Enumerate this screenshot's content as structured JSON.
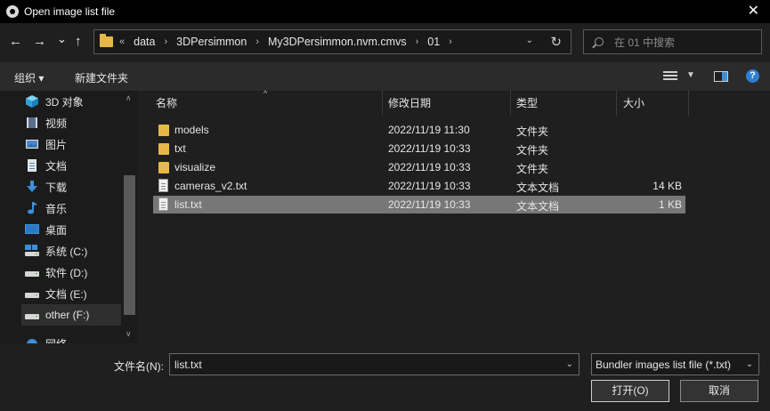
{
  "window": {
    "title": "Open image list file",
    "close_glyph": "✕"
  },
  "nav": {
    "back_glyph": "←",
    "forward_glyph": "→",
    "recent_glyph": "⌄",
    "up_glyph": "↑",
    "breadcrumb_overflow": "«",
    "breadcrumbs": [
      "data",
      "3DPersimmon",
      "My3DPersimmon.nvm.cmvs",
      "01"
    ],
    "search_placeholder": "在 01 中搜索"
  },
  "toolbar": {
    "organize": "组织 ▾",
    "new_folder": "新建文件夹",
    "help": "?"
  },
  "sidebar": {
    "items": [
      {
        "label": "3D 对象",
        "icon": "cube-icon"
      },
      {
        "label": "视频",
        "icon": "video-icon"
      },
      {
        "label": "图片",
        "icon": "picture-icon"
      },
      {
        "label": "文档",
        "icon": "document-icon"
      },
      {
        "label": "下载",
        "icon": "download-icon"
      },
      {
        "label": "音乐",
        "icon": "music-icon"
      },
      {
        "label": "桌面",
        "icon": "desktop-icon"
      },
      {
        "label": "系统 (C:)",
        "icon": "drive-icon"
      },
      {
        "label": "软件 (D:)",
        "icon": "drive-icon"
      },
      {
        "label": "文档 (E:)",
        "icon": "drive-icon"
      },
      {
        "label": "other (F:)",
        "icon": "drive-icon",
        "selected": true
      },
      {
        "label": "网络",
        "icon": "network-icon"
      }
    ]
  },
  "files": {
    "columns": {
      "name": "名称",
      "modified": "修改日期",
      "type": "类型",
      "size": "大小"
    },
    "rows": [
      {
        "name": "models",
        "modified": "2022/11/19 11:30",
        "type": "文件夹",
        "size": "",
        "kind": "folder"
      },
      {
        "name": "txt",
        "modified": "2022/11/19 10:33",
        "type": "文件夹",
        "size": "",
        "kind": "folder"
      },
      {
        "name": "visualize",
        "modified": "2022/11/19 10:33",
        "type": "文件夹",
        "size": "",
        "kind": "folder"
      },
      {
        "name": "cameras_v2.txt",
        "modified": "2022/11/19 10:33",
        "type": "文本文档",
        "size": "14 KB",
        "kind": "file"
      },
      {
        "name": "list.txt",
        "modified": "2022/11/19 10:33",
        "type": "文本文档",
        "size": "1 KB",
        "kind": "file",
        "selected": true
      }
    ]
  },
  "bottom": {
    "filename_label": "文件名(N):",
    "filename_value": "list.txt",
    "filter_value": "Bundler images list file (*.txt)",
    "open_button": "打开(O)",
    "cancel_button": "取消"
  },
  "colors": {
    "folder": "#e6b84a",
    "selection": "#777777",
    "accent": "#2f7fd1"
  }
}
